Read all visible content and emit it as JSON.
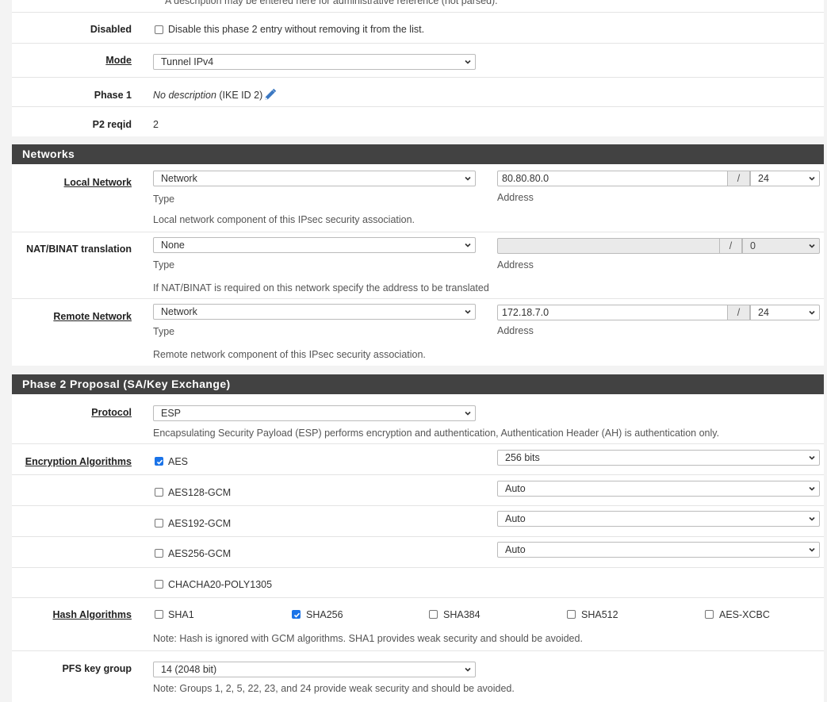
{
  "general": {
    "top_help": "A description may be entered here for administrative reference (not parsed).",
    "disabled": {
      "label": "Disabled",
      "checkbox_text": "Disable this phase 2 entry without removing it from the list.",
      "checked": false
    },
    "mode": {
      "label": "Mode",
      "value": "Tunnel IPv4"
    },
    "phase1": {
      "label": "Phase 1",
      "desc_italic": "No description",
      "desc_suffix": " (IKE ID 2)",
      "icon": "pencil-icon"
    },
    "p2reqid": {
      "label": "P2 reqid",
      "value": "2"
    }
  },
  "networks": {
    "heading": "Networks",
    "local": {
      "label": "Local Network",
      "type_value": "Network",
      "type_caption": "Type",
      "address_value": "80.80.80.0",
      "slash": "/",
      "mask": "24",
      "address_caption": "Address",
      "help": "Local network component of this IPsec security association."
    },
    "natbinat": {
      "label": "NAT/BINAT translation",
      "type_value": "None",
      "type_caption": "Type",
      "address_value": "",
      "slash": "/",
      "mask": "0",
      "address_caption": "Address",
      "help": "If NAT/BINAT is required on this network specify the address to be translated"
    },
    "remote": {
      "label": "Remote Network",
      "type_value": "Network",
      "type_caption": "Type",
      "address_value": "172.18.7.0",
      "slash": "/",
      "mask": "24",
      "address_caption": "Address",
      "help": "Remote network component of this IPsec security association."
    }
  },
  "proposal": {
    "heading": "Phase 2 Proposal (SA/Key Exchange)",
    "protocol": {
      "label": "Protocol",
      "value": "ESP",
      "help": "Encapsulating Security Payload (ESP) performs encryption and authentication, Authentication Header (AH) is authentication only."
    },
    "encryption": {
      "label": "Encryption Algorithms",
      "items": [
        {
          "name": "AES",
          "checked": true,
          "keylen": "256 bits"
        },
        {
          "name": "AES128-GCM",
          "checked": false,
          "keylen": "Auto"
        },
        {
          "name": "AES192-GCM",
          "checked": false,
          "keylen": "Auto"
        },
        {
          "name": "AES256-GCM",
          "checked": false,
          "keylen": "Auto"
        },
        {
          "name": "CHACHA20-POLY1305",
          "checked": false
        }
      ]
    },
    "hash": {
      "label": "Hash Algorithms",
      "items": [
        {
          "name": "SHA1",
          "checked": false
        },
        {
          "name": "SHA256",
          "checked": true
        },
        {
          "name": "SHA384",
          "checked": false
        },
        {
          "name": "SHA512",
          "checked": false
        },
        {
          "name": "AES-XCBC",
          "checked": false
        }
      ],
      "note": "Note: Hash is ignored with GCM algorithms. SHA1 provides weak security and should be avoided."
    },
    "pfs": {
      "label": "PFS key group",
      "value": "14 (2048 bit)",
      "note": "Note: Groups 1, 2, 5, 22, 23, and 24 provide weak security and should be avoided."
    }
  },
  "colors": {
    "heading_bg": "#424242",
    "checkbox_checked": "#1a73e8",
    "link_icon": "#3b78c2"
  }
}
